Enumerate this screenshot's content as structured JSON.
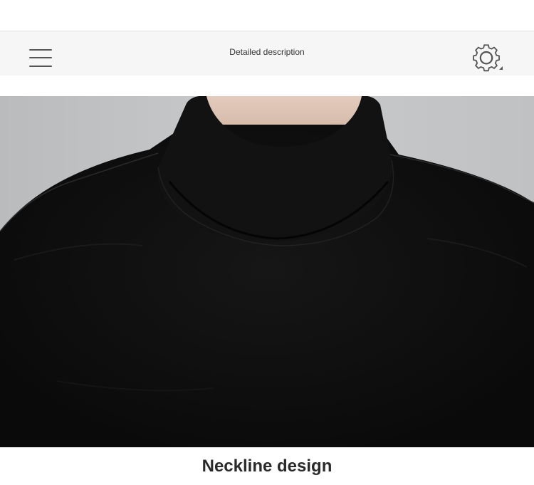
{
  "header": {
    "title": "Detailed description",
    "menu_icon": "hamburger-menu-icon",
    "settings_icon": "gear-icon"
  },
  "product_image": {
    "subject": "black mock-neck sweatshirt"
  },
  "caption": {
    "text": "Neckline design"
  },
  "colors": {
    "header_bg": "#f6f6f6",
    "garment": "#141414",
    "background_gray": "#c3c5c7",
    "skin": "#d9c1b2",
    "caption_text": "#2a2a2a"
  }
}
